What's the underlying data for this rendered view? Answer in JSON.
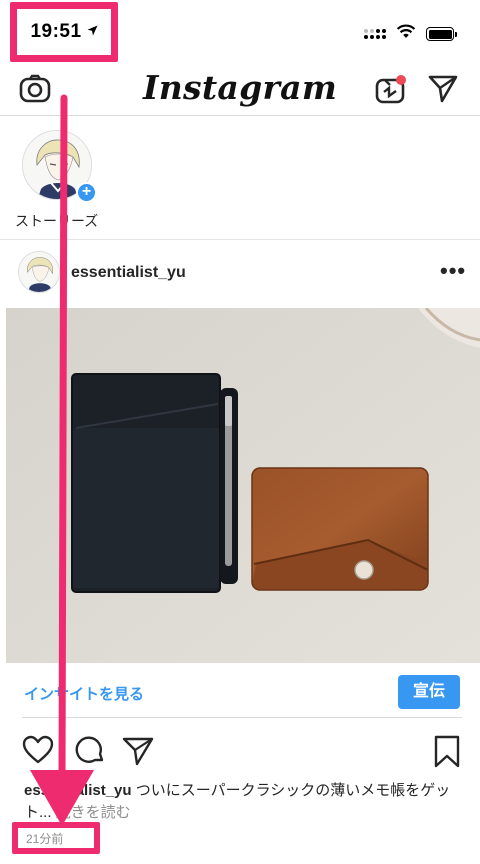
{
  "status_bar": {
    "time": "19:51"
  },
  "nav": {
    "logo": "Instagram"
  },
  "stories": {
    "label": "ストーリーズ",
    "add_symbol": "+"
  },
  "post": {
    "username": "essentialist_yu",
    "more_symbol": "•••",
    "insights_link": "インサイトを見る",
    "promote_button": "宣伝",
    "caption_user": "essentialist_yu",
    "caption_text": " ついにスーパークラシックの薄いメモ帳をゲット... ",
    "caption_more": "続きを読む",
    "time_ago": "21分前"
  },
  "icons": {
    "location": "location-arrow-icon",
    "signal": "cellular-signal-icon",
    "wifi": "wifi-icon",
    "battery": "battery-icon",
    "camera": "camera-icon",
    "igtv": "igtv-icon",
    "direct": "direct-message-icon",
    "like": "heart-icon",
    "comment": "comment-icon",
    "share": "share-icon",
    "save": "bookmark-icon"
  },
  "colors": {
    "accent_link": "#3897f0",
    "highlight": "#ef2b6f",
    "notification_dot": "#ed4956",
    "muted_text": "#8e8e8e"
  }
}
